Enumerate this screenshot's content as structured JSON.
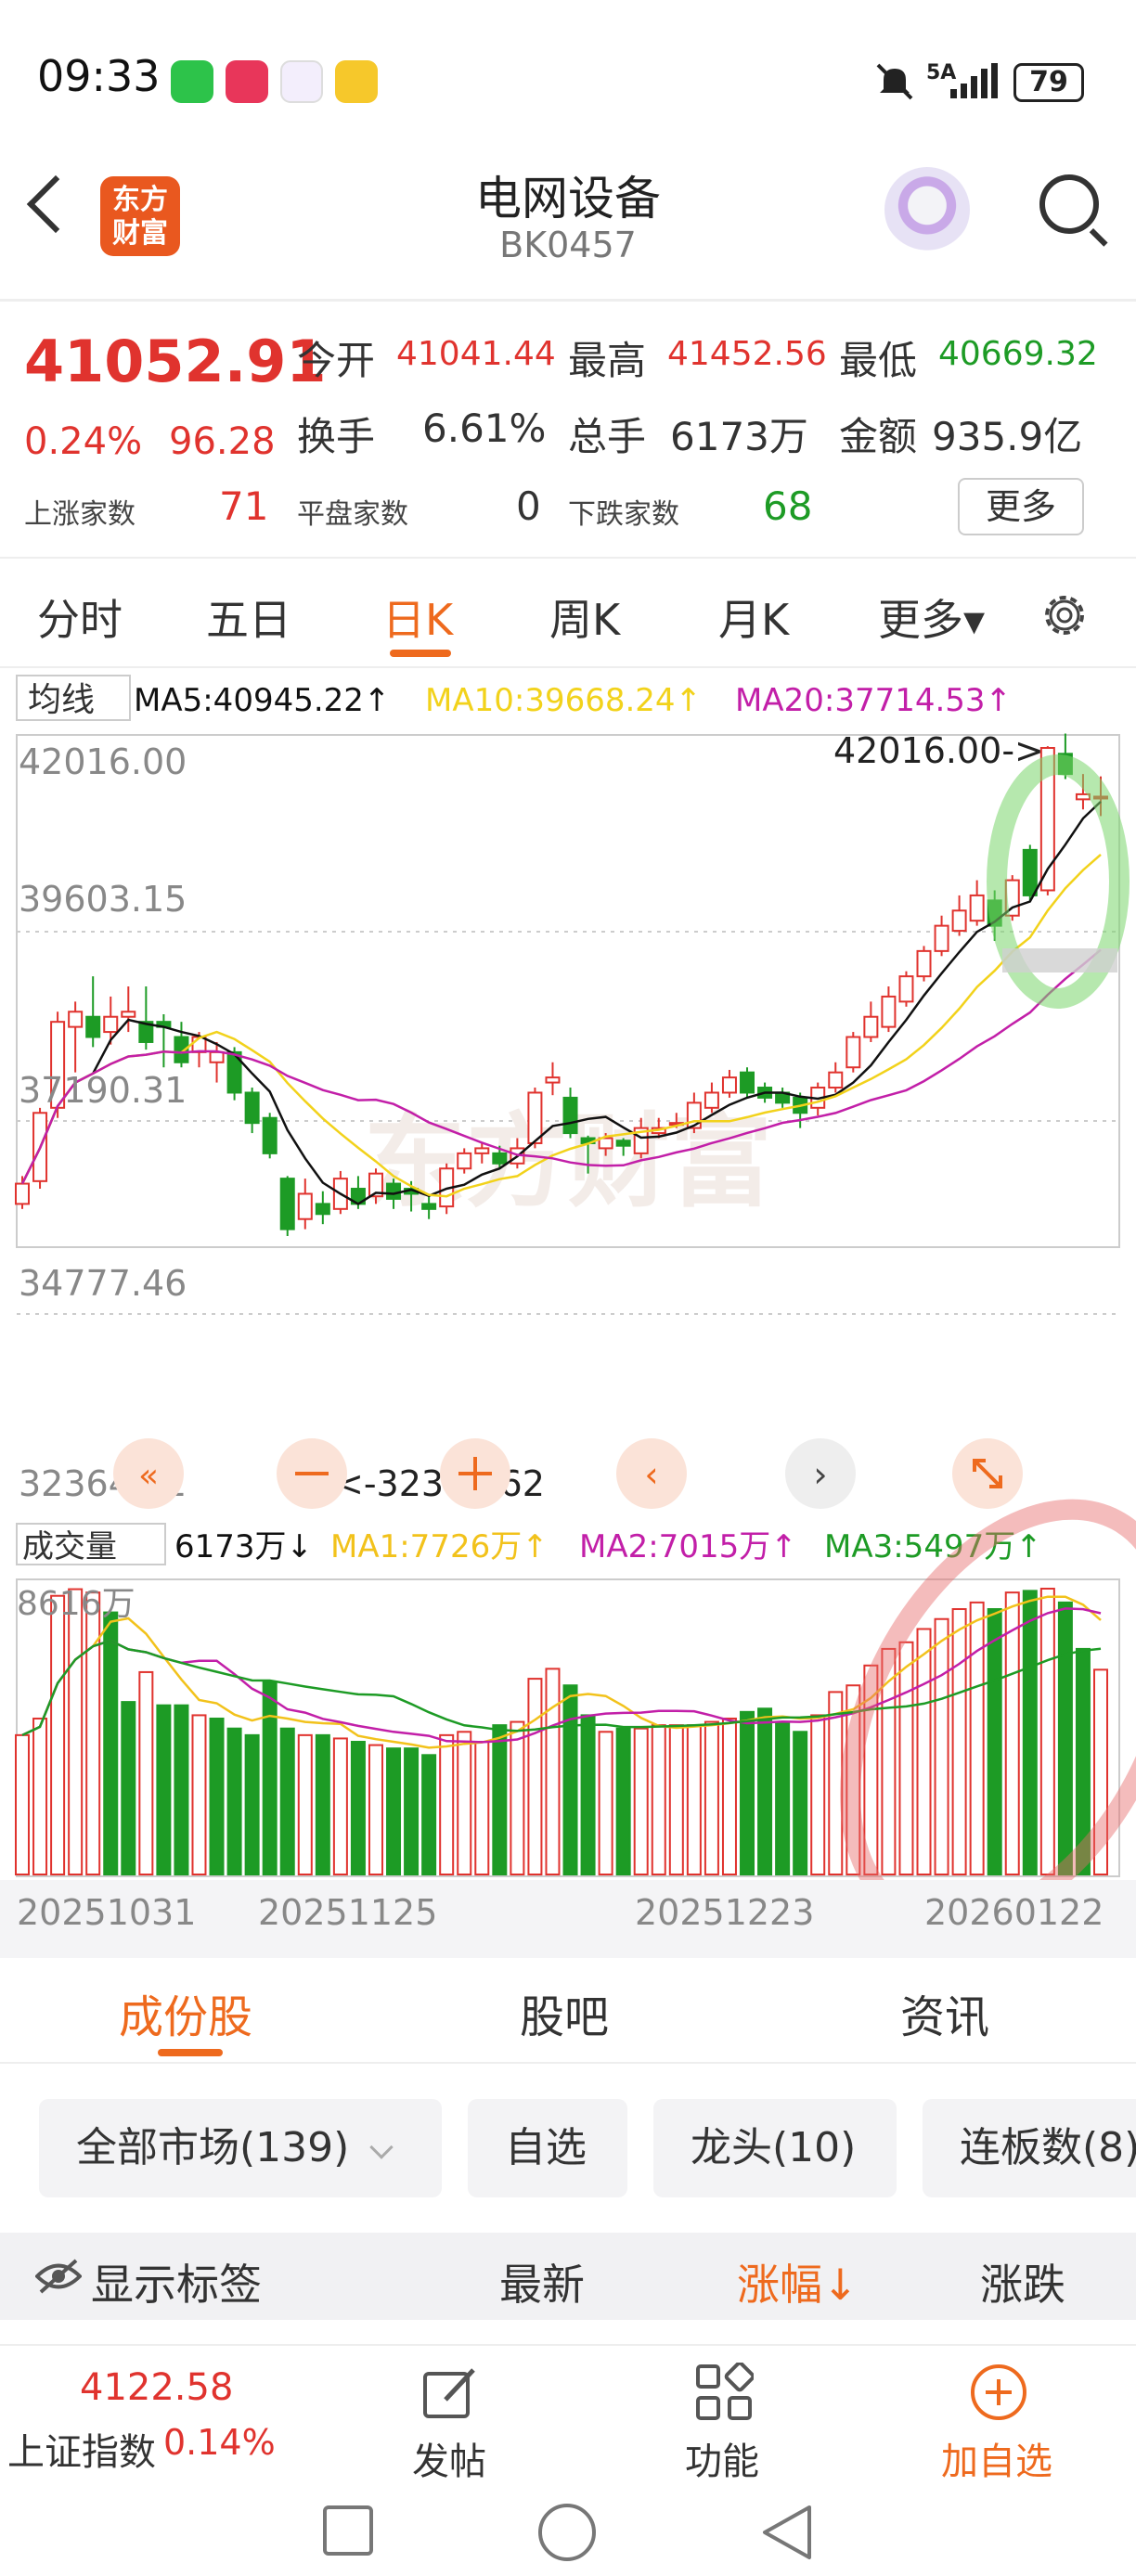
{
  "status_bar": {
    "time": "09:33",
    "signal": "5A",
    "battery": "79"
  },
  "header": {
    "title": "电网设备",
    "code": "BK0457",
    "logo_text": "东方\n财富",
    "icons": [
      "back-icon",
      "robot-avatar-icon",
      "search-icon"
    ]
  },
  "quote": {
    "price": "41052.91",
    "change_pct": "0.24%",
    "change": "96.28",
    "open_label": "今开",
    "open": "41041.44",
    "high_label": "最高",
    "high": "41452.56",
    "low_label": "最低",
    "low": "40669.32",
    "turnover_label": "换手",
    "turnover": "6.61%",
    "volume_label": "总手",
    "volume": "6173万",
    "amount_label": "金额",
    "amount": "935.9亿",
    "up_label": "上涨家数",
    "up": "71",
    "flat_label": "平盘家数",
    "flat": "0",
    "down_label": "下跌家数",
    "down": "68",
    "more": "更多"
  },
  "ktabs": {
    "t1": "分时",
    "t2": "五日",
    "t3": "日K",
    "t4": "周K",
    "t5": "月K",
    "t6": "更多▾"
  },
  "ma_bar": {
    "selector": "均线",
    "ma5": "MA5:40945.22↑",
    "ma10": "MA10:39668.24↑",
    "ma20": "MA20:37714.53↑"
  },
  "price_axis": [
    "42016.00",
    "39603.15",
    "37190.31",
    "34777.46",
    "32364.62"
  ],
  "max_label": "42016.00->",
  "min_label": "<-32364.62",
  "watermark": "东方财富",
  "vol_bar": {
    "selector": "成交量",
    "vol": "6173万↓",
    "ma1": "MA1:7726万↑",
    "ma2": "MA2:7015万↑",
    "ma3": "MA3:5497万↑"
  },
  "vol_axis": "8616万",
  "dates": [
    "20251031",
    "20251125",
    "20251223",
    "20260122"
  ],
  "colors": {
    "up": "#e0332e",
    "down": "#1d9b25",
    "accent": "#ee6a1e",
    "ma5": "#111111",
    "ma10": "#f2d21b",
    "ma20": "#c21fa8"
  },
  "chart_data": {
    "type": "candlestick",
    "ylim": [
      32364.62,
      42016.0
    ],
    "candles": [
      [
        33000,
        33400,
        32900,
        33550
      ],
      [
        33450,
        34800,
        33300,
        34900
      ],
      [
        34900,
        36600,
        34700,
        36800
      ],
      [
        36500,
        36800,
        35600,
        37000
      ],
      [
        36700,
        36300,
        36100,
        37500
      ],
      [
        36400,
        36700,
        36150,
        37100
      ],
      [
        36700,
        36800,
        36400,
        37300
      ],
      [
        36600,
        36200,
        36050,
        37300
      ],
      [
        36600,
        36500,
        35700,
        36750
      ],
      [
        36300,
        35800,
        35700,
        36600
      ],
      [
        36000,
        36300,
        35700,
        36400
      ],
      [
        35800,
        36000,
        35400,
        36200
      ],
      [
        36000,
        35200,
        35050,
        36100
      ],
      [
        35200,
        34600,
        34400,
        35300
      ],
      [
        34700,
        34000,
        33900,
        34800
      ],
      [
        33500,
        32500,
        32364,
        33550
      ],
      [
        32700,
        33200,
        32500,
        33500
      ],
      [
        33000,
        32800,
        32600,
        33250
      ],
      [
        32900,
        33500,
        32800,
        33650
      ],
      [
        33300,
        33000,
        32900,
        33550
      ],
      [
        33150,
        33600,
        33000,
        33700
      ],
      [
        33400,
        33100,
        32900,
        33500
      ],
      [
        33300,
        33200,
        32850,
        33450
      ],
      [
        33000,
        32900,
        32700,
        33200
      ],
      [
        32950,
        33700,
        32800,
        33800
      ],
      [
        33700,
        34000,
        33600,
        34100
      ],
      [
        34000,
        34100,
        33800,
        34200
      ],
      [
        34000,
        33800,
        33700,
        34150
      ],
      [
        33800,
        34100,
        33700,
        34300
      ],
      [
        34200,
        35200,
        34100,
        35300
      ],
      [
        35400,
        35500,
        35150,
        35800
      ],
      [
        35100,
        34400,
        34300,
        35300
      ],
      [
        34300,
        34200,
        33600,
        34350
      ],
      [
        34100,
        34300,
        33950,
        34400
      ],
      [
        34250,
        34150,
        33950,
        34300
      ],
      [
        34000,
        34500,
        33900,
        34700
      ],
      [
        34400,
        34500,
        34300,
        34700
      ],
      [
        34600,
        34600,
        34500,
        34800
      ],
      [
        34500,
        35000,
        34400,
        35200
      ],
      [
        34900,
        35200,
        34800,
        35400
      ],
      [
        35200,
        35500,
        35100,
        35650
      ],
      [
        35600,
        35200,
        35100,
        35700
      ],
      [
        35300,
        35100,
        35000,
        35400
      ],
      [
        35200,
        35000,
        34900,
        35300
      ],
      [
        35100,
        34800,
        34500,
        35200
      ],
      [
        34900,
        35300,
        34750,
        35400
      ],
      [
        35300,
        35600,
        35200,
        35800
      ],
      [
        35700,
        36300,
        35600,
        36400
      ],
      [
        36300,
        36700,
        36200,
        37000
      ],
      [
        36500,
        37100,
        36400,
        37300
      ],
      [
        37000,
        37500,
        36900,
        37600
      ],
      [
        37500,
        38000,
        37400,
        38100
      ],
      [
        38000,
        38500,
        37900,
        38700
      ],
      [
        38400,
        38800,
        38300,
        39100
      ],
      [
        38600,
        39100,
        38500,
        39400
      ],
      [
        39000,
        38500,
        38200,
        39200
      ],
      [
        38700,
        39400,
        38600,
        39500
      ],
      [
        40000,
        39100,
        39000,
        40100
      ],
      [
        39200,
        42016,
        39100,
        42050
      ],
      [
        41900,
        41500,
        41400,
        42300
      ],
      [
        41000,
        41100,
        40800,
        41500
      ],
      [
        41044,
        41053,
        40669,
        41453
      ]
    ],
    "volume_max_label": "8616万",
    "volumes": [
      4200,
      4700,
      8400,
      8600,
      8500,
      7900,
      5200,
      6100,
      5100,
      5100,
      4800,
      4700,
      4400,
      4200,
      5800,
      4400,
      4200,
      4200,
      4100,
      4000,
      3900,
      3800,
      3800,
      3600,
      4200,
      4300,
      4000,
      4500,
      4600,
      5900,
      6200,
      5700,
      4800,
      4300,
      4400,
      4400,
      4500,
      4500,
      4500,
      4600,
      4700,
      4900,
      5000,
      4600,
      4300,
      4800,
      5500,
      5700,
      6300,
      6800,
      7000,
      7400,
      7700,
      8000,
      8200,
      8000,
      8500,
      8550,
      8616,
      8200,
      6800,
      6173
    ],
    "volume_down": [
      false,
      false,
      false,
      false,
      false,
      true,
      true,
      false,
      true,
      true,
      false,
      true,
      true,
      true,
      true,
      true,
      false,
      true,
      false,
      true,
      false,
      true,
      true,
      true,
      false,
      false,
      false,
      true,
      false,
      false,
      false,
      true,
      true,
      false,
      true,
      false,
      false,
      false,
      false,
      false,
      false,
      true,
      true,
      true,
      true,
      false,
      false,
      false,
      false,
      false,
      false,
      false,
      false,
      false,
      false,
      true,
      false,
      true,
      false,
      true,
      true,
      false
    ],
    "x_tick_labels": [
      "20251031",
      "20251125",
      "20251223",
      "20260122"
    ]
  },
  "lower_tabs": {
    "t1": "成份股",
    "t2": "股吧",
    "t3": "资讯"
  },
  "filters": {
    "f1": "全部市场(139)",
    "f2": "自选",
    "f3": "龙头(10)",
    "f4": "连板数(8)"
  },
  "list_header": {
    "show_tags": "显示标签",
    "latest": "最新",
    "change_pct": "涨幅↓",
    "change": "涨跌"
  },
  "bottom_bar": {
    "index_value": "4122.58",
    "index_name": "上证指数",
    "index_change": "0.14%",
    "post": "发帖",
    "func": "功能",
    "add": "加自选"
  }
}
